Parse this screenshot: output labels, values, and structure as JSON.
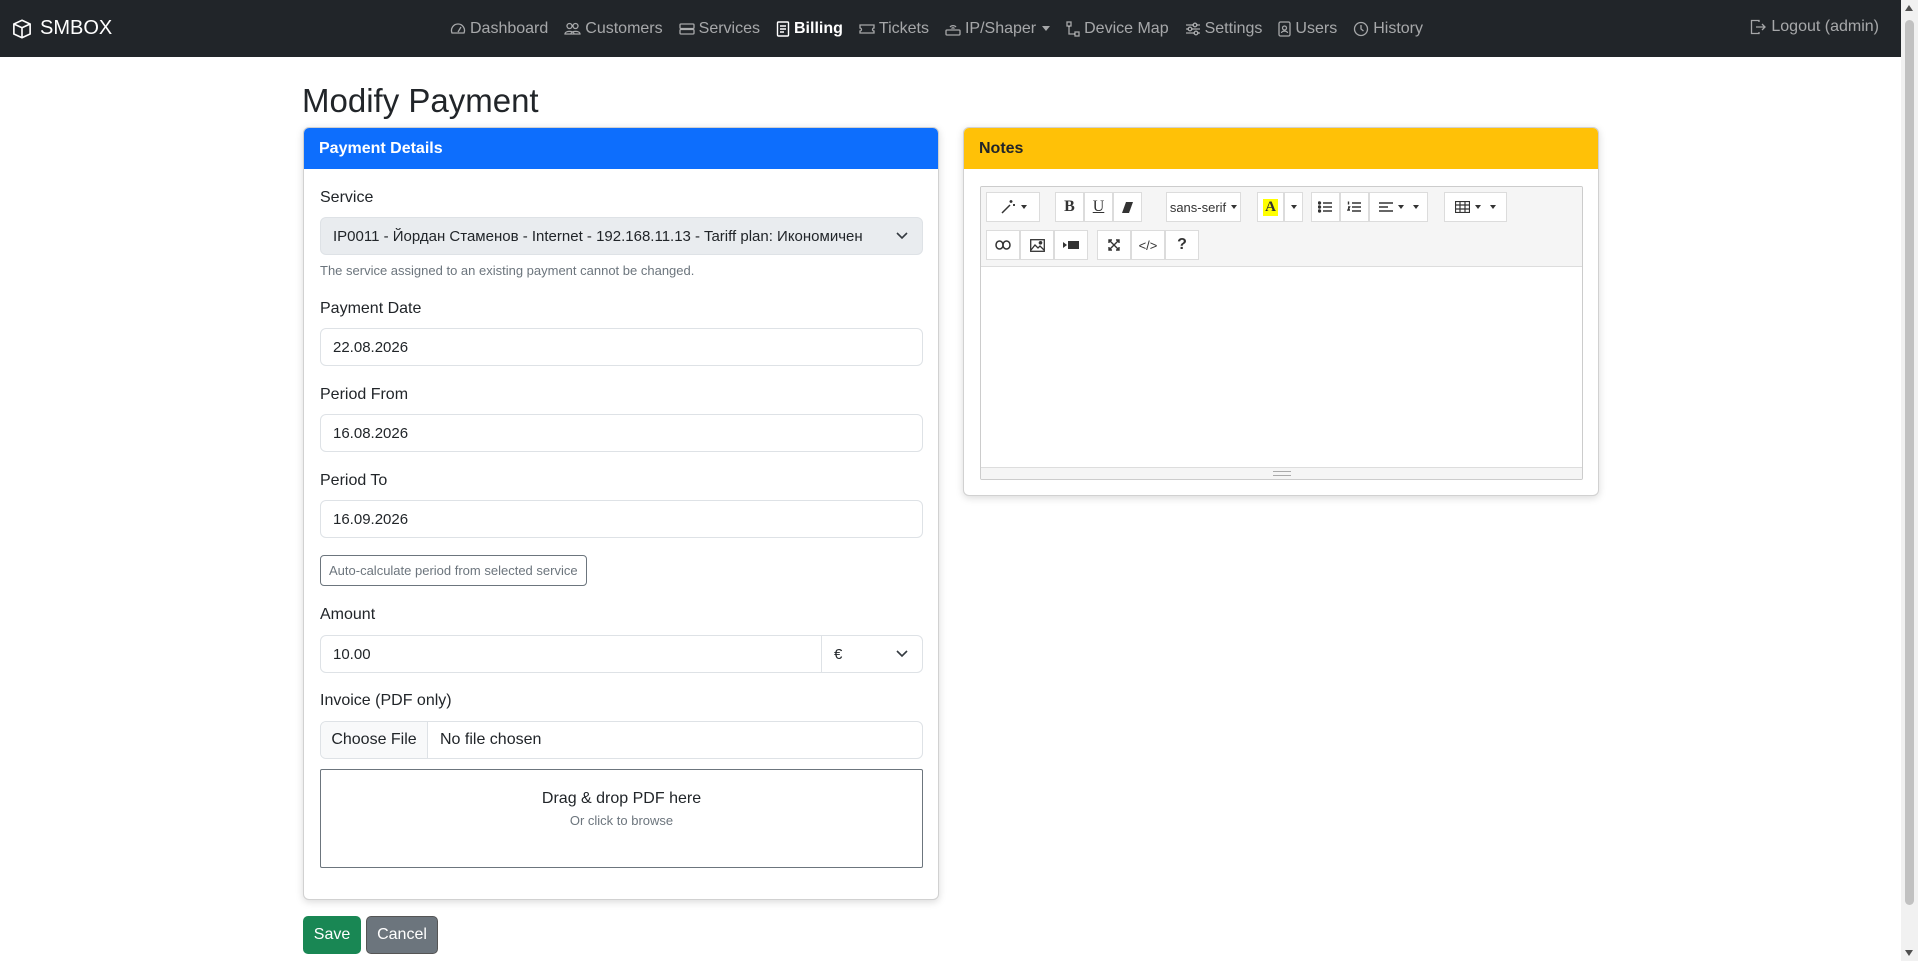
{
  "brand": {
    "name": "SMBOX"
  },
  "nav": {
    "items": [
      {
        "label": "Dashboard",
        "icon": "speedometer-icon"
      },
      {
        "label": "Customers",
        "icon": "people-icon"
      },
      {
        "label": "Services",
        "icon": "hdd-rack-icon"
      },
      {
        "label": "Billing",
        "icon": "receipt-icon",
        "active": true
      },
      {
        "label": "Tickets",
        "icon": "ticket-icon"
      },
      {
        "label": "IP/Shaper",
        "icon": "router-icon",
        "dropdown": true
      },
      {
        "label": "Device Map",
        "icon": "diagram-icon"
      },
      {
        "label": "Settings",
        "icon": "sliders-icon"
      },
      {
        "label": "Users",
        "icon": "person-badge-icon"
      },
      {
        "label": "History",
        "icon": "clock-history-icon"
      }
    ],
    "logout_label": "Logout (admin)"
  },
  "page": {
    "title": "Modify Payment"
  },
  "payment": {
    "header": "Payment Details",
    "service_label": "Service",
    "service_value": "IP0011 - Йордан Стаменов - Internet - 192.168.11.13 - Tariff plan: Икономичен",
    "service_help": "The service assigned to an existing payment cannot be changed.",
    "date_label": "Payment Date",
    "date_value": "22.08.2026",
    "period_from_label": "Period From",
    "period_from_value": "16.08.2026",
    "period_to_label": "Period To",
    "period_to_value": "16.09.2026",
    "autocalc_label": "Auto-calculate period from selected service",
    "amount_label": "Amount",
    "amount_value": "10.00",
    "currency_value": "€",
    "invoice_label": "Invoice (PDF only)",
    "file_button": "Choose File",
    "file_status": "No file chosen",
    "dropzone_main": "Drag & drop PDF here",
    "dropzone_sub": "Or click to browse"
  },
  "notes": {
    "header": "Notes",
    "font_name": "sans-serif",
    "colors": {
      "highlight": "#ffff00"
    }
  },
  "actions": {
    "save_label": "Save",
    "cancel_label": "Cancel"
  },
  "theme": {
    "navbar": "#212529",
    "primary": "#0d6efd",
    "warning": "#ffc107",
    "success": "#198754",
    "secondary": "#6c757d"
  }
}
